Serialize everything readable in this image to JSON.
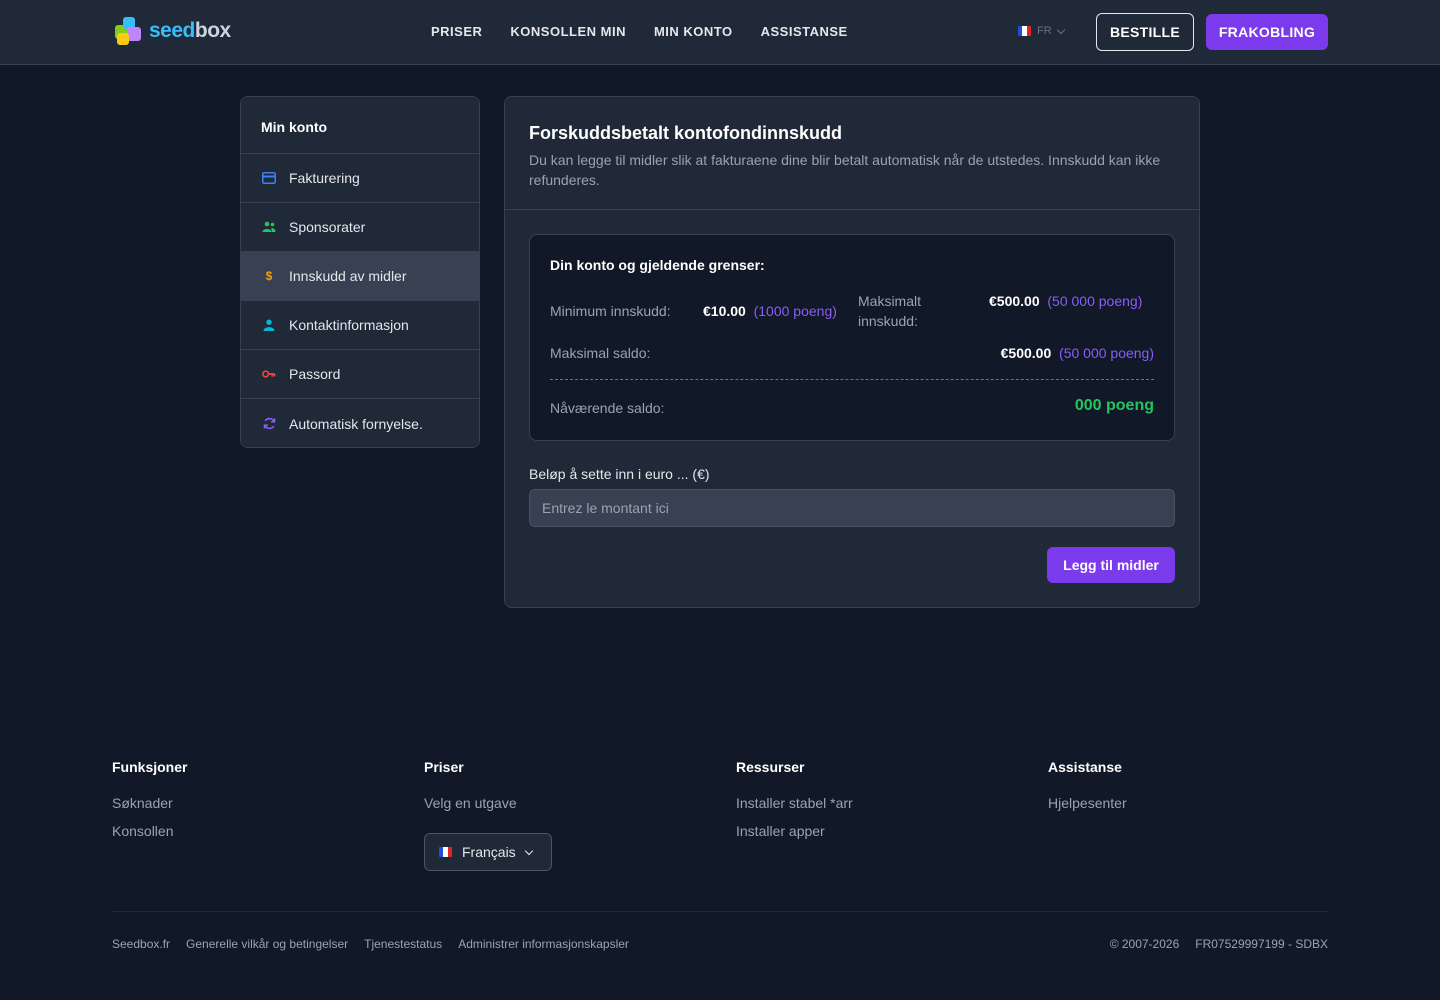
{
  "header": {
    "logo_text_a": "seed",
    "logo_text_b": "box",
    "nav": [
      "PRISER",
      "KONSOLLEN MIN",
      "MIN KONTO",
      "ASSISTANSE"
    ],
    "lang_code": "FR",
    "order_button": "BESTILLE",
    "logout_button": "FRAKOBLING"
  },
  "sidebar": {
    "title": "Min konto",
    "items": [
      {
        "label": "Fakturering",
        "icon": "credit-card-icon",
        "color": "#3b82f6"
      },
      {
        "label": "Sponsorater",
        "icon": "users-icon",
        "color": "#22c55e"
      },
      {
        "label": "Innskudd av midler",
        "icon": "dollar-icon",
        "color": "#f59e0b",
        "active": true
      },
      {
        "label": "Kontaktinformasjon",
        "icon": "user-icon",
        "color": "#06b6d4"
      },
      {
        "label": "Passord",
        "icon": "key-icon",
        "color": "#ef4444"
      },
      {
        "label": "Automatisk fornyelse.",
        "icon": "refresh-icon",
        "color": "#8b5cf6"
      }
    ]
  },
  "main": {
    "title": "Forskuddsbetalt kontofondinnskudd",
    "description": "Du kan legge til midler slik at fakturaene dine blir betalt automatisk når de utstedes. Innskudd kan ikke refunderes.",
    "limits": {
      "title": "Din konto og gjeldende grenser:",
      "min_label": "Minimum innskudd:",
      "min_amount": "€10.00",
      "min_points": "(1000 poeng)",
      "max_label": "Maksimalt innskudd:",
      "max_amount": "€500.00",
      "max_points": "(50 000 poeng)",
      "max_balance_label": "Maksimal saldo:",
      "max_balance_amount": "€500.00",
      "max_balance_points": "(50 000 poeng)",
      "current_label": "Nåværende saldo:",
      "current_value": "000 poeng"
    },
    "amount_label": "Beløp å sette inn i euro ... (€)",
    "amount_placeholder": "Entrez le montant ici",
    "add_button": "Legg til midler"
  },
  "footer": {
    "columns": [
      {
        "title": "Funksjoner",
        "links": [
          "Søknader",
          "Konsollen"
        ]
      },
      {
        "title": "Priser",
        "links": [
          "Velg en utgave"
        ]
      },
      {
        "title": "Ressurser",
        "links": [
          "Installer stabel *arr",
          "Installer apper"
        ]
      },
      {
        "title": "Assistanse",
        "links": [
          "Hjelpesenter"
        ]
      }
    ],
    "language": "Français",
    "bottom_links": [
      "Seedbox.fr",
      "Generelle vilkår og betingelser",
      "Tjenestestatus",
      "Administrer informasjonskapsler"
    ],
    "copyright": "© 2007-2026",
    "company_id": "FR07529997199 - SDBX"
  },
  "colors": {
    "accent": "#7c3aed",
    "success": "#22c55e",
    "points": "#8b5cf6"
  }
}
